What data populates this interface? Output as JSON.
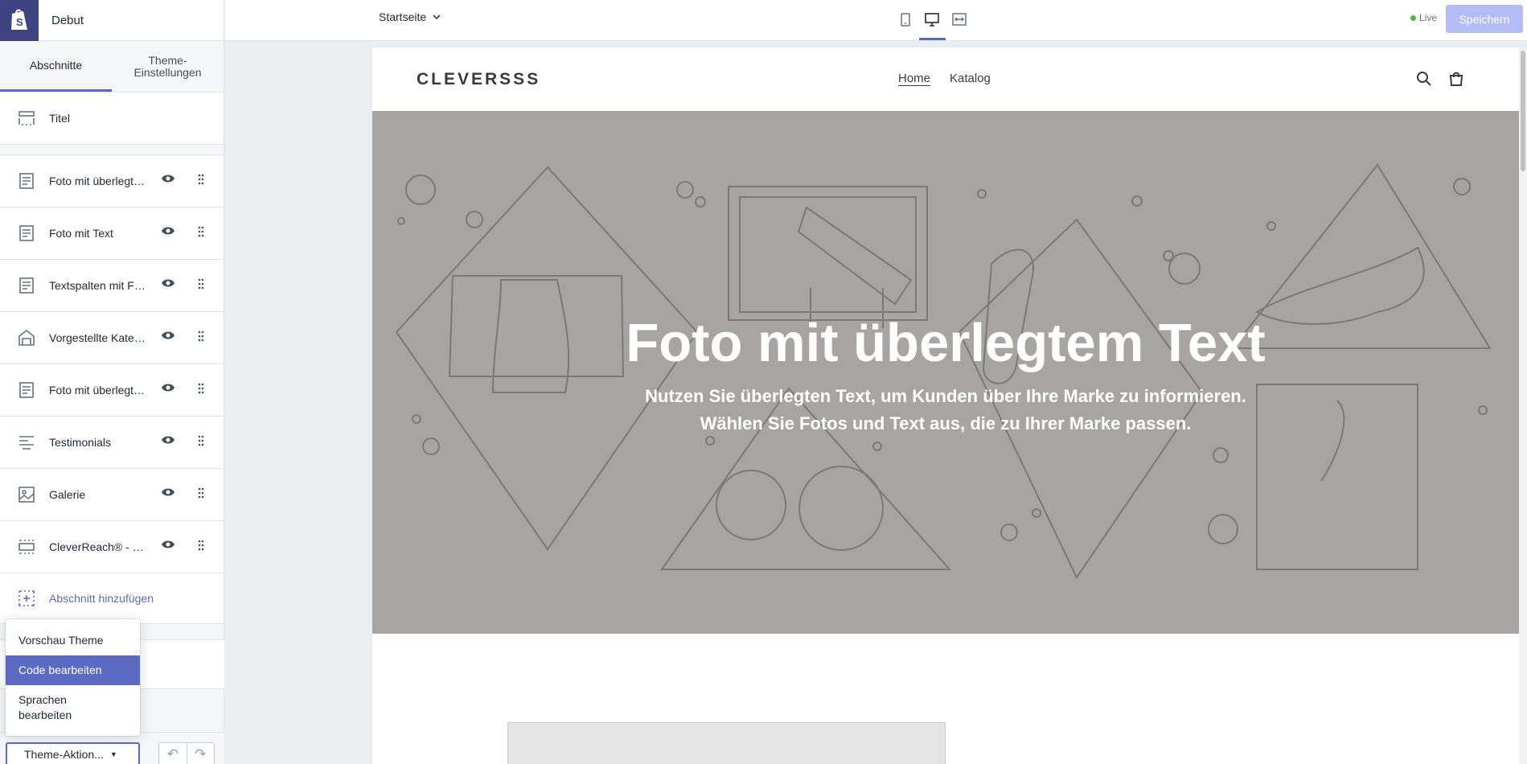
{
  "app": {
    "theme_name": "Debut",
    "page_selector": "Startseite",
    "status": "Live",
    "save_label": "Speichern",
    "accent": "#5c6ac4"
  },
  "sidebar": {
    "tabs": [
      {
        "label": "Abschnitte",
        "active": true
      },
      {
        "label": "Theme-\nEinstellungen",
        "active": false
      }
    ],
    "header_section": {
      "label": "Titel",
      "icon": "header-section-icon"
    },
    "sections": [
      {
        "label": "Foto mit überlegtem Text",
        "icon": "text-block-icon"
      },
      {
        "label": "Foto mit Text",
        "icon": "text-block-icon"
      },
      {
        "label": "Textspalten mit Fotos",
        "icon": "text-block-icon"
      },
      {
        "label": "Vorgestellte Kategorie",
        "icon": "collection-icon"
      },
      {
        "label": "Foto mit überlegtem Text",
        "icon": "text-block-icon"
      },
      {
        "label": "Testimonials",
        "icon": "testimonials-icon"
      },
      {
        "label": "Galerie",
        "icon": "image-icon"
      },
      {
        "label": "CleverReach® - Signup",
        "icon": "footer-section-icon"
      }
    ],
    "add_section_label": "Abschnitt hinzufügen",
    "theme_actions_label": "Theme-Aktion...",
    "dropdown": [
      {
        "label": "Vorschau Theme",
        "selected": false
      },
      {
        "label": "Code bearbeiten",
        "selected": true
      },
      {
        "label": "Sprachen\nbearbeiten",
        "selected": false
      }
    ]
  },
  "preview": {
    "shop_name": "CLEVERSSS",
    "nav": [
      {
        "label": "Home",
        "current": true
      },
      {
        "label": "Katalog",
        "current": false
      }
    ],
    "hero_title": "Foto mit überlegtem Text",
    "hero_subtitle_line1": "Nutzen Sie überlegten Text, um Kunden über Ihre Marke zu informieren.",
    "hero_subtitle_line2": "Wählen Sie Fotos und Text aus, die zu Ihrer Marke passen.",
    "hero_bg": "#a9a4a4"
  }
}
